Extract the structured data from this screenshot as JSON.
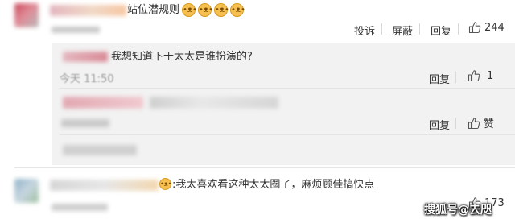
{
  "comment1": {
    "text_suffix": "站位潜规则",
    "emoji_icons": [
      "dog-face-icon",
      "dog-face-icon",
      "dog-face-icon",
      "dog-face-icon"
    ],
    "actions": {
      "report": "投诉",
      "block": "屏蔽",
      "reply": "回复"
    },
    "like_count": "244"
  },
  "reply1": {
    "text": "我想知道下于太太是谁扮演的?",
    "time": "今天 11:50",
    "reply_label": "回复",
    "like_count": "1"
  },
  "reply2": {
    "reply_label": "回复",
    "like_label": "赞"
  },
  "comment2": {
    "text": ":我太喜欢看这种太太圈了，麻烦顾佳搞快点",
    "like_count": "173"
  },
  "watermark": {
    "text": "搜狐号@去咫"
  },
  "colors": {
    "background": "#ffffff",
    "reply_background": "#f2f2f2",
    "text": "#333333",
    "divider": "#e6e6e6"
  }
}
